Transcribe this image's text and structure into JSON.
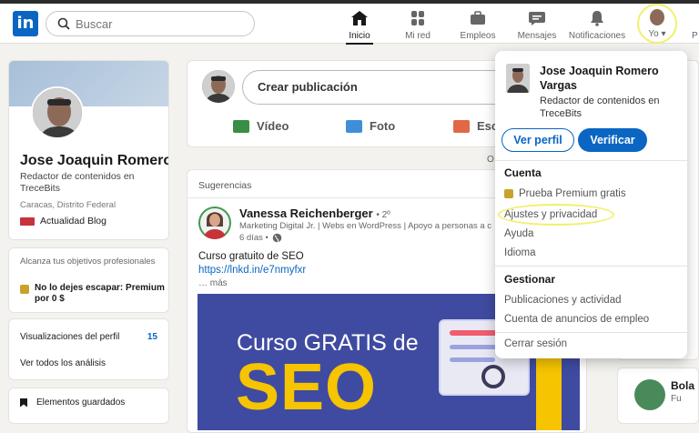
{
  "header": {
    "logo_text": "in",
    "search_placeholder": "Buscar",
    "nav": [
      {
        "label": "Inicio",
        "icon": "home-icon"
      },
      {
        "label": "Mi red",
        "icon": "network-icon"
      },
      {
        "label": "Empleos",
        "icon": "briefcase-icon"
      },
      {
        "label": "Mensajes",
        "icon": "messaging-icon"
      },
      {
        "label": "Notificaciones",
        "icon": "bell-icon"
      },
      {
        "label": "Yo",
        "icon": "avatar"
      }
    ],
    "nav_cut": "P"
  },
  "profile": {
    "name": "Jose Joaquin Romero...",
    "headline": "Redactor de contenidos en TreceBits",
    "location": "Caracas, Distrito Federal",
    "blog": "Actualidad Blog"
  },
  "premium": {
    "tagline": "Alcanza tus objetivos profesionales",
    "cta": "No lo dejes escapar: Premium por 0 $"
  },
  "stats": {
    "views_label": "Visualizaciones del perfil",
    "views_value": "15",
    "analytics": "Ver todos los análisis"
  },
  "saved": "Elementos guardados",
  "share": {
    "create": "Crear publicación",
    "video": "Vídeo",
    "photo": "Foto",
    "write": "Escr",
    "cut_o": "O"
  },
  "feed": {
    "section": "Sugerencias",
    "post": {
      "author": "Vanessa Reichenberger",
      "degree": "• 2º",
      "headline": "Marketing Digital Jr. | Webs en WordPress | Apoyo a personas a c",
      "time": "6 días •",
      "text": "Curso gratuito de SEO",
      "link": "https://lnkd.in/e7nmyfxr",
      "more": "… más",
      "image_line1": "Curso GRATIS de",
      "image_line2": "SEO"
    }
  },
  "right": {
    "name": "Bola",
    "sub": "Fu"
  },
  "dropdown": {
    "name": "Jose Joaquin Romero Vargas",
    "headline": "Redactor de contenidos en TreceBits",
    "view_profile": "Ver perfil",
    "verify": "Verificar",
    "account_title": "Cuenta",
    "premium": "Prueba Premium gratis",
    "settings": "Ajustes y privacidad",
    "help": "Ayuda",
    "language": "Idioma",
    "manage_title": "Gestionar",
    "posts": "Publicaciones y actividad",
    "job_ads": "Cuenta de anuncios de empleo",
    "logout": "Cerrar sesión"
  },
  "colors": {
    "brand": "#0a66c2",
    "highlight": "#f2f06a",
    "premium_gold": "#c9a22d"
  }
}
